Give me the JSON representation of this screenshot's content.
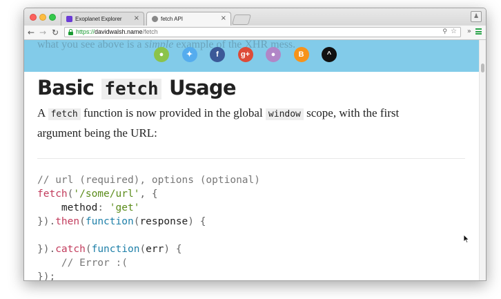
{
  "browser": {
    "tabs": [
      {
        "title": "Exoplanet Explorer",
        "close": "×"
      },
      {
        "title": "fetch API",
        "close": "×"
      }
    ],
    "url": {
      "proto": "https://",
      "host": "davidwalsh.name",
      "path": "/fetch"
    },
    "profile_icon": "person-icon"
  },
  "page": {
    "banner_behind_text": "what you see above is a",
    "banner_behind_emph": "simple",
    "banner_behind_rest": "example of the XHR mess.",
    "share_icons": [
      {
        "name": "comment-icon",
        "glyph": "●",
        "color": "#8bc34a"
      },
      {
        "name": "twitter-icon",
        "glyph": "✦",
        "color": "#55acee"
      },
      {
        "name": "facebook-icon",
        "glyph": "f",
        "color": "#3b5998"
      },
      {
        "name": "googleplus-icon",
        "glyph": "g+",
        "color": "#dd4b39"
      },
      {
        "name": "reddit-icon",
        "glyph": "●",
        "color": "#b186c7"
      },
      {
        "name": "bitcoin-icon",
        "glyph": "B",
        "color": "#f7931a"
      },
      {
        "name": "chevron-up-icon",
        "glyph": "^",
        "color": "#111111"
      }
    ],
    "heading_pre": "Basic",
    "heading_code": "fetch",
    "heading_post": "Usage",
    "para_1": "A",
    "para_code_1": "fetch",
    "para_2": "function is now provided in the global",
    "para_code_2": "window",
    "para_3": "scope, with the first argument being the URL:",
    "code": {
      "l1": "// url (required), options (optional)",
      "l2_fn": "fetch",
      "l2_punc1": "(",
      "l2_str": "'/some/url'",
      "l2_punc2": ", {",
      "l3_key": "    method",
      "l3_punc": ": ",
      "l3_str": "'get'",
      "l4_punc1": "}).",
      "l4_fn": "then",
      "l4_punc2": "(",
      "l4_kw": "function",
      "l4_punc3": "(",
      "l4_arg": "response",
      "l4_punc4": ") {",
      "l5": "",
      "l6_punc1": "}).",
      "l6_fn": "catch",
      "l6_punc2": "(",
      "l6_kw": "function",
      "l6_punc3": "(",
      "l6_arg": "err",
      "l6_punc4": ") {",
      "l7": "    // Error :(",
      "l8": "});"
    }
  }
}
